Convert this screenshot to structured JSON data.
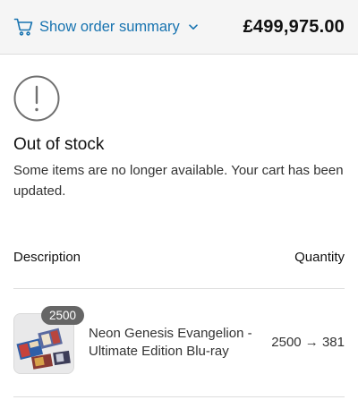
{
  "header": {
    "toggle_label": "Show order summary",
    "total": "£499,975.00",
    "cart_icon": "cart-icon",
    "chevron_icon": "chevron-down-icon"
  },
  "notice": {
    "icon": "alert-circle-icon",
    "title": "Out of stock",
    "message": "Some items are no longer available. Your cart has been updated."
  },
  "table": {
    "headers": {
      "description": "Description",
      "quantity": "Quantity"
    },
    "rows": [
      {
        "badge": "2500",
        "name": "Neon Genesis Evangelion - Ultimate Edition Blu-ray",
        "quantity_change": "2500 → 381"
      }
    ]
  },
  "colors": {
    "link": "#1773b0",
    "badge_bg": "#666666",
    "summary_bg": "#f5f5f5"
  }
}
